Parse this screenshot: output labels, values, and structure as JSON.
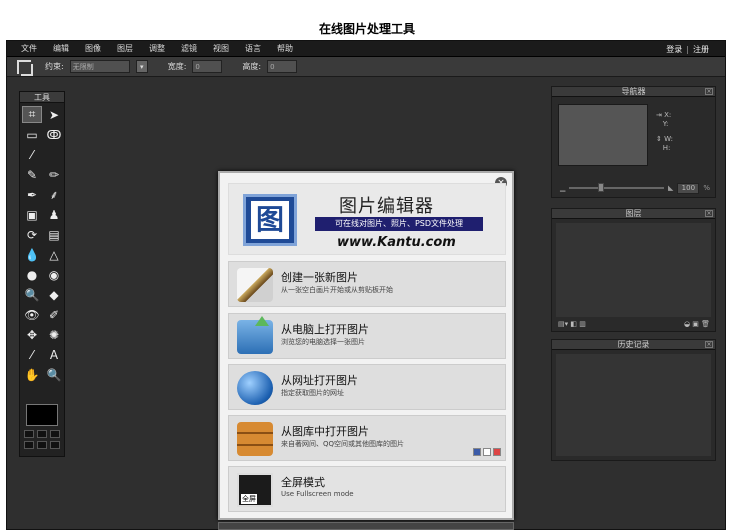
{
  "page_title": "在线图片处理工具",
  "menubar": {
    "items": [
      "文件",
      "编辑",
      "图像",
      "图层",
      "调整",
      "滤镜",
      "视图",
      "语言",
      "帮助"
    ],
    "login": "登录",
    "separator": "|",
    "register": "注册"
  },
  "toolopts": {
    "constraint_label": "约束:",
    "constraint_value": "无限制",
    "arrow": "▾",
    "width_label": "宽度:",
    "width_value": "0",
    "height_label": "高度:",
    "height_value": "0"
  },
  "tools": {
    "header": "工具",
    "glyphs": [
      "⌗",
      "➤",
      "▭",
      "ↂ",
      "⁄",
      "",
      "✎",
      "✏",
      "✒",
      "⸙",
      "▣",
      "♟",
      "⟳",
      "▤",
      "💧",
      "△",
      "●",
      "◉",
      "🔍",
      "◆",
      "👁",
      "✐",
      "✥",
      "✺",
      "⁄",
      "A",
      "✋",
      "🔍"
    ]
  },
  "navigator": {
    "title": "导航器",
    "x_label": "X:",
    "y_label": "Y:",
    "w_label": "W:",
    "h_label": "H:",
    "zoom": "100",
    "zoom_unit": "%"
  },
  "layers": {
    "title": "图层"
  },
  "history": {
    "title": "历史记录"
  },
  "dialog": {
    "close": "×",
    "logo_glyph": "图",
    "app_name": "图片编辑器",
    "tagline": "可在线对图片、照片、PSD文件处理",
    "url": "www.Kantu.com",
    "options": [
      {
        "title": "创建一张新图片",
        "desc": "从一张空白画片开始或从剪贴板开始"
      },
      {
        "title": "从电脑上打开图片",
        "desc": "浏览您的电脑选择一张图片"
      },
      {
        "title": "从网址打开图片",
        "desc": "指定获取图片的网址"
      },
      {
        "title": "从图库中打开图片",
        "desc": "来自著网间、QQ空间或其他图库的图片"
      },
      {
        "title": "全屏模式",
        "desc": "Use Fullscreen mode"
      }
    ],
    "fullscreen_icon_label": "全屏"
  }
}
